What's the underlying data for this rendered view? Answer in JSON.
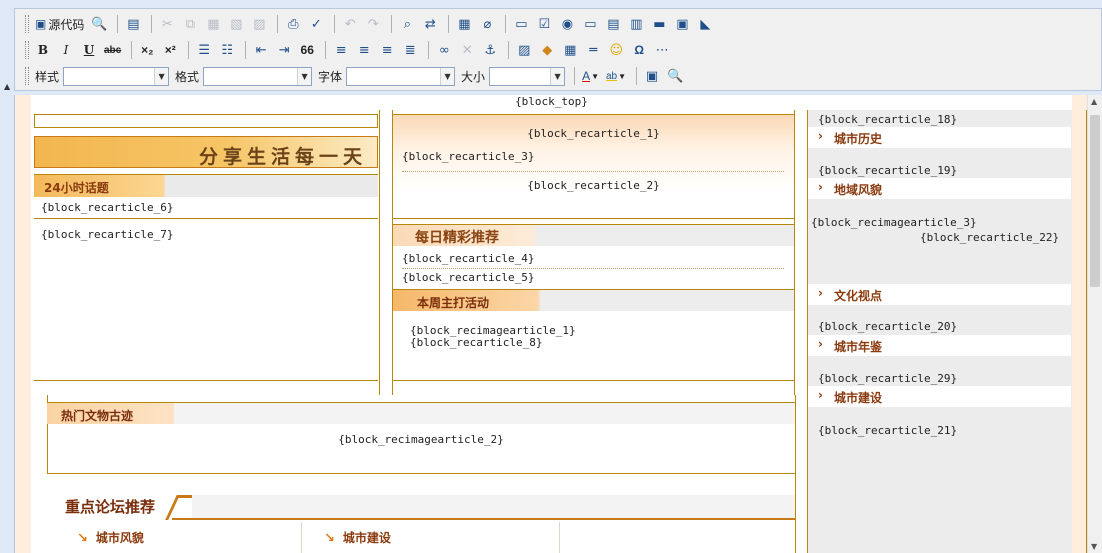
{
  "toolbar": {
    "source_label": "源代码",
    "style_label": "样式",
    "format_label": "格式",
    "font_label": "字体",
    "size_label": "大小",
    "bold": "B",
    "italic": "I",
    "underline": "U",
    "strike": "abc",
    "subscript": "×₂",
    "superscript": "×²",
    "quote": "66",
    "omega": "Ω",
    "text_color": "A",
    "bg_color": "ab"
  },
  "page": {
    "block_top": "{block_top}",
    "slogan": "分享生活每一天",
    "left": {
      "hot_topics_title": "24小时话题",
      "rec6": "{block_recarticle_6}",
      "rec7": "{block_recarticle_7}"
    },
    "middle": {
      "rec1": "{block_recarticle_1}",
      "rec3": "{block_recarticle_3}",
      "rec2": "{block_recarticle_2}",
      "daily_title": "每日精彩推荐",
      "rec4": "{block_recarticle_4}",
      "rec5": "{block_recarticle_5}",
      "weekly_title": "本周主打活动",
      "recimg1": "{block_recimagearticle_1}",
      "rec8": "{block_recarticle_8}"
    },
    "right": {
      "rec18": "{block_recarticle_18}",
      "city_history": "城市历史",
      "rec19": "{block_recarticle_19}",
      "regional_style": "地域风貌",
      "recimg3": "{block_recimagearticle_3}",
      "rec22": "{block_recarticle_22}",
      "cultural_view": "文化视点",
      "rec20": "{block_recarticle_20}",
      "city_yearbook": "城市年鉴",
      "rec29": "{block_recarticle_29}",
      "city_construction": "城市建设",
      "rec21": "{block_recarticle_21}"
    },
    "relics": {
      "title": "热门文物古迹",
      "recimg2": "{block_recimagearticle_2}"
    },
    "forum": {
      "title": "重点论坛推荐",
      "link1": "城市风貌",
      "link2": "城市建设"
    }
  },
  "colors": {
    "accent_brown": "#8b3a0e",
    "border_gold": "#b8860b",
    "banner_orange": "#f3b64f",
    "toolbar_bg": "#dfe8f6"
  }
}
